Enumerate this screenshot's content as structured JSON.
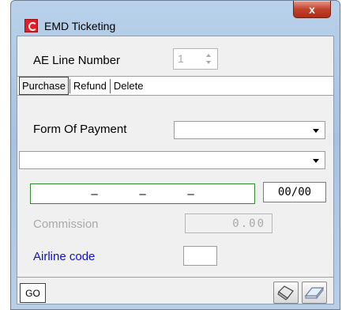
{
  "window": {
    "title": "EMD Ticketing",
    "close_label": "x"
  },
  "ae_line": {
    "label": "AE Line Number",
    "value": "1"
  },
  "tabs": [
    {
      "label": "Purchase",
      "active": true
    },
    {
      "label": "Refund",
      "active": false
    },
    {
      "label": "Delete",
      "active": false
    }
  ],
  "payment": {
    "form_of_payment_label": "Form Of Payment",
    "form_of_payment_value": "",
    "second_dropdown_value": "",
    "card_number_segments": [
      "–",
      "–",
      "–"
    ],
    "expiry_value": "00/00"
  },
  "commission": {
    "label": "Commission",
    "value": "0.00"
  },
  "airline": {
    "label": "Airline code",
    "value": ""
  },
  "footer": {
    "go_label": "GO",
    "eraser_icon": "eraser-icon",
    "clear_icon": "clear-icon"
  },
  "colors": {
    "accent_blue": "#1010c8",
    "card_border_green": "#2e8b2e",
    "disabled_gray": "#a9a9a9",
    "app_icon_red": "#e31e24"
  }
}
